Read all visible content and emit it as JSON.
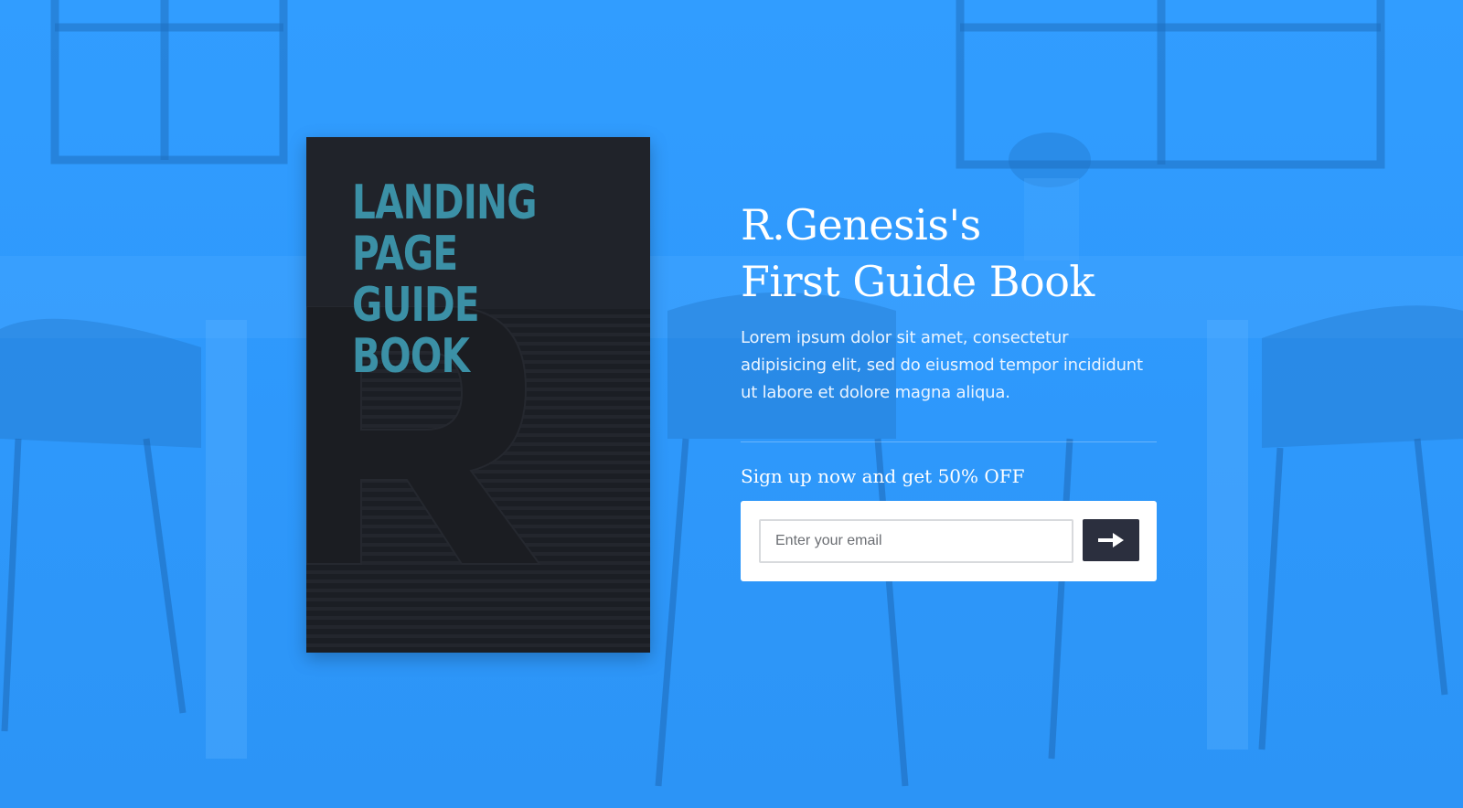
{
  "book": {
    "title_line1": "LANDING PAGE",
    "title_line2": "GUIDE BOOK",
    "cover_letter": "R"
  },
  "hero": {
    "headline_line1": "R.Genesis's",
    "headline_line2": "First Guide Book",
    "description": "Lorem ipsum dolor sit amet, consectetur adipisicing elit, sed do eiusmod tempor incididunt ut labore et dolore magna aliqua."
  },
  "signup": {
    "heading": "Sign up now and get 50% OFF",
    "email_placeholder": "Enter your email",
    "email_value": "",
    "submit_icon": "arrow-right-icon"
  },
  "colors": {
    "background": "#2f9bfd",
    "book_cover": "#20232a",
    "book_title": "#3b90a6",
    "button": "#2b2f3e"
  }
}
